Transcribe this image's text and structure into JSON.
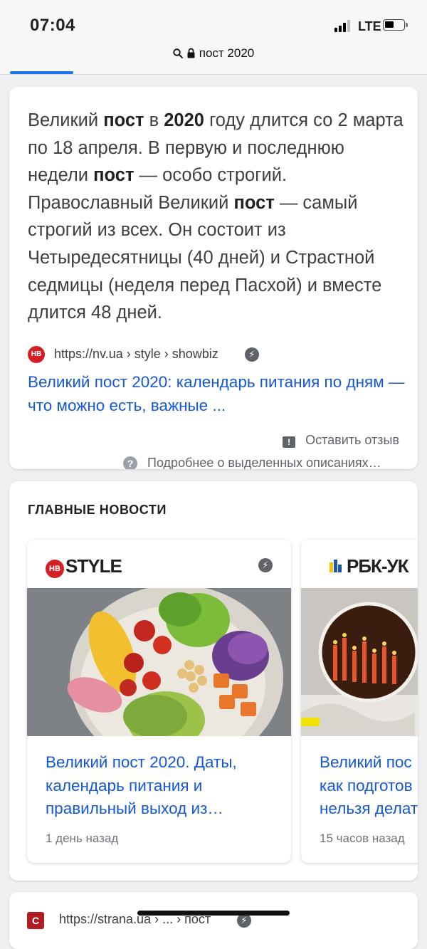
{
  "status_bar": {
    "time": "07:04",
    "network": "LTE"
  },
  "browser": {
    "url": "пост 2020"
  },
  "featured_snippet": {
    "text_parts": [
      {
        "t": "Великий ",
        "b": false
      },
      {
        "t": "пост",
        "b": true
      },
      {
        "t": " в ",
        "b": false
      },
      {
        "t": "2020",
        "b": true
      },
      {
        "t": " году длится со 2 марта по 18 апреля. В первую и последнюю недели ",
        "b": false
      },
      {
        "t": "пост",
        "b": true
      },
      {
        "t": " — особо строгий. Православный Великий ",
        "b": false
      },
      {
        "t": "пост",
        "b": true
      },
      {
        "t": " — самый строгий из всех. Он состоит из Четыредесятницы (40 дней) и Страстной седмицы (неделя перед Пасхой) и вместе длится 48 дней.",
        "b": false
      }
    ],
    "source_favicon": "НВ",
    "source_url": "https://nv.ua › style › showbiz",
    "link_title": "Великий пост 2020: календарь питания по дням — что можно есть, важные ...",
    "feedback_label": "Оставить отзыв",
    "more_info_label": "Подробнее о выделенных описаниях…"
  },
  "top_stories": {
    "heading": "ГЛАВНЫЕ НОВОСТИ",
    "items": [
      {
        "logo_mark": "НВ",
        "brand": "STYLE",
        "headline": "Великий пост 2020. Даты, календарь питания и правильный выход из…",
        "time_ago": "1 день назад"
      },
      {
        "brand": "РБК-УК",
        "headline_lines": [
          "Великий пос",
          "как подготов",
          "нельзя делат"
        ],
        "time_ago": "15 часов назад"
      }
    ]
  },
  "next_result": {
    "favicon": "С",
    "url": "https://strana.ua › ... › пост"
  },
  "colors": {
    "link": "#1558d6",
    "accent": "#1a73e8",
    "brand_red": "#d32027"
  },
  "icons": [
    "search-icon",
    "lock-icon",
    "amp-lightning-icon",
    "feedback-icon",
    "help-icon"
  ]
}
